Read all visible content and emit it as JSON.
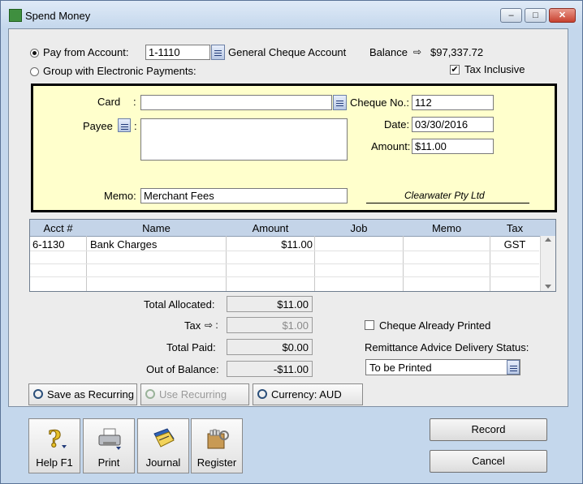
{
  "window": {
    "title": "Spend Money"
  },
  "header": {
    "pay_from_label": "Pay from Account:",
    "account_number": "1-1110",
    "account_name": "General Cheque Account",
    "balance_label": "Balance",
    "balance_value": "$97,337.72",
    "group_label": "Group with Electronic Payments:",
    "tax_inclusive_label": "Tax Inclusive",
    "tax_inclusive_checked": "✔"
  },
  "cheque": {
    "card_label": "Card",
    "card_value": "",
    "payee_label": "Payee",
    "payee_value": "",
    "cheque_no_label": "Cheque No.:",
    "cheque_no": "112",
    "date_label": "Date:",
    "date": "03/30/2016",
    "amount_label": "Amount:",
    "amount": "$11.00",
    "memo_label": "Memo:",
    "memo": "Merchant Fees",
    "company": "Clearwater Pty Ltd"
  },
  "table": {
    "headers": [
      "Acct #",
      "Name",
      "Amount",
      "Job",
      "Memo",
      "Tax"
    ],
    "rows": [
      {
        "acct": "6-1130",
        "name": "Bank Charges",
        "amount": "$11.00",
        "job": "",
        "memo": "",
        "tax": "GST"
      }
    ]
  },
  "totals": {
    "allocated_label": "Total Allocated:",
    "allocated": "$11.00",
    "tax_label": "Tax",
    "tax": "$1.00",
    "paid_label": "Total Paid:",
    "paid": "$0.00",
    "balance_label": "Out of Balance:",
    "balance": "-$11.00"
  },
  "options": {
    "cheque_printed_label": "Cheque Already Printed",
    "remittance_label": "Remittance Advice Delivery Status:",
    "remittance_value": "To be Printed"
  },
  "toolbar": {
    "save_recurring": "Save as Recurring",
    "use_recurring": "Use Recurring",
    "currency_label": "Currency:",
    "currency_value": "AUD"
  },
  "bottom": {
    "help": "Help F1",
    "print": "Print",
    "journal": "Journal",
    "register": "Register",
    "record": "Record",
    "cancel": "Cancel"
  },
  "colors": {
    "yellow_panel": "#ffffcc",
    "window_frame": "#c4d7ec",
    "table_header": "#c4d4e8"
  }
}
